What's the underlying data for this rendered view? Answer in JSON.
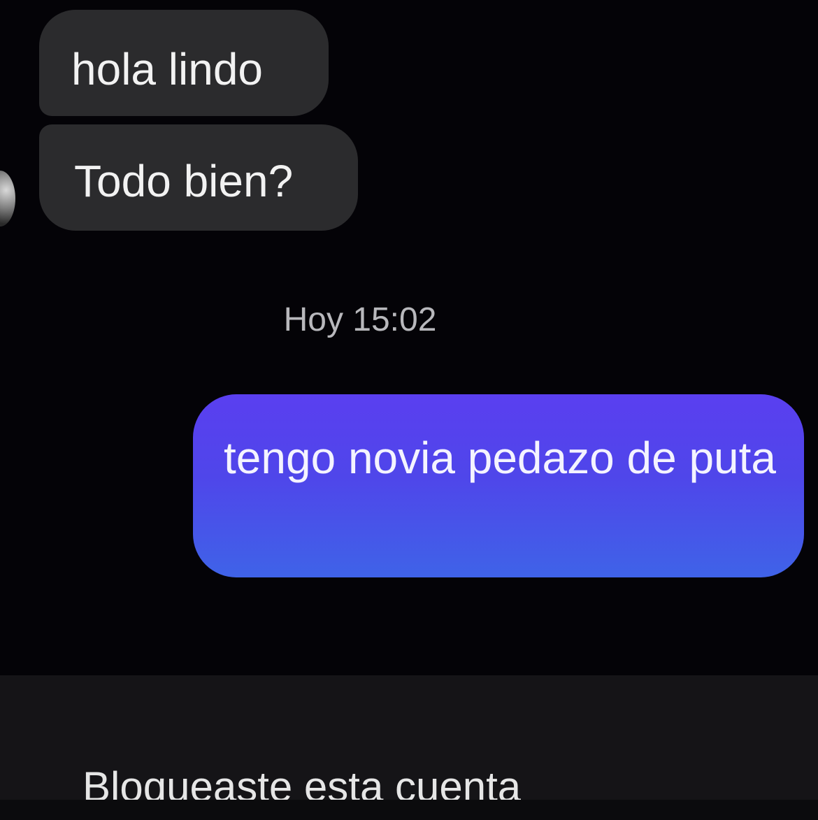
{
  "conversation": {
    "messages": [
      {
        "direction": "incoming",
        "text": "hola lindo"
      },
      {
        "direction": "incoming",
        "text": "Todo bien?"
      },
      {
        "direction": "outgoing",
        "text": "tengo novia pedazo de puta"
      }
    ],
    "timestamp": "Hoy 15:02"
  },
  "footer": {
    "status_text": "Bloqueaste esta cuenta"
  },
  "colors": {
    "background": "#040307",
    "incoming_bubble": "#2b2b2d",
    "outgoing_bubble": "#4f46ea",
    "footer": "#151417"
  }
}
